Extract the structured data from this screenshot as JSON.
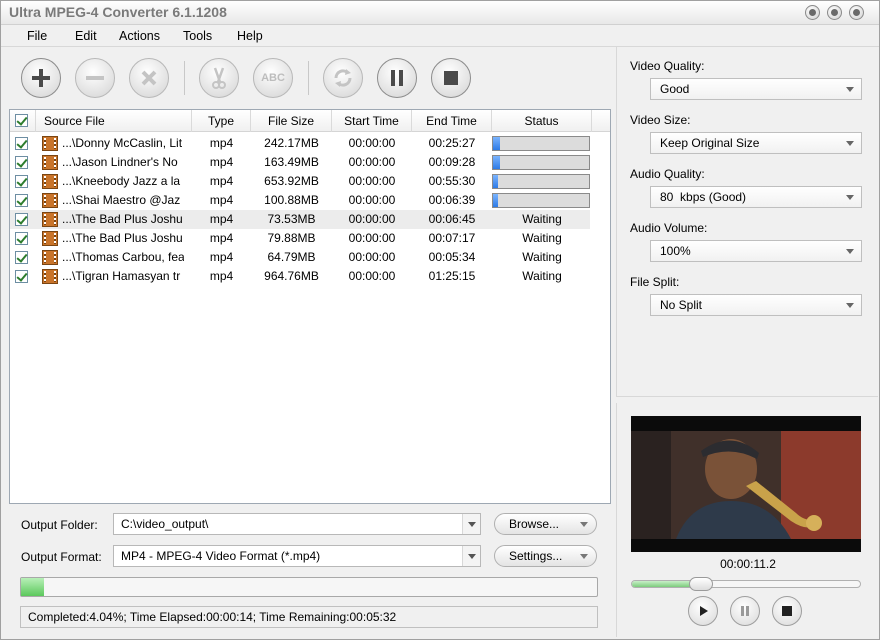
{
  "window": {
    "title": "Ultra MPEG-4 Converter 6.1.1208"
  },
  "menu": [
    "File",
    "Edit",
    "Actions",
    "Tools",
    "Help"
  ],
  "toolbar": {
    "buttons": [
      "add-icon",
      "remove-icon",
      "clear-icon",
      "cut-icon",
      "rename-icon",
      "convert-icon",
      "pause-icon",
      "stop-icon"
    ],
    "rename_label": "ABC"
  },
  "columns": [
    "Source File",
    "Type",
    "File Size",
    "Start Time",
    "End Time",
    "Status"
  ],
  "files": [
    {
      "name": "...\\Donny McCaslin, Lit",
      "type": "mp4",
      "size": "242.17MB",
      "start": "00:00:00",
      "end": "00:25:27",
      "status": "",
      "progress": 0.07
    },
    {
      "name": "...\\Jason Lindner's No",
      "type": "mp4",
      "size": "163.49MB",
      "start": "00:00:00",
      "end": "00:09:28",
      "status": "",
      "progress": 0.07
    },
    {
      "name": "...\\Kneebody  Jazz a la",
      "type": "mp4",
      "size": "653.92MB",
      "start": "00:00:00",
      "end": "00:55:30",
      "status": "",
      "progress": 0.05
    },
    {
      "name": "...\\Shai Maestro @Jaz",
      "type": "mp4",
      "size": "100.88MB",
      "start": "00:00:00",
      "end": "00:06:39",
      "status": "",
      "progress": 0.05
    },
    {
      "name": "...\\The Bad Plus Joshu",
      "type": "mp4",
      "size": "73.53MB",
      "start": "00:00:00",
      "end": "00:06:45",
      "status": "Waiting",
      "progress": null
    },
    {
      "name": "...\\The Bad Plus Joshu",
      "type": "mp4",
      "size": "79.88MB",
      "start": "00:00:00",
      "end": "00:07:17",
      "status": "Waiting",
      "progress": null
    },
    {
      "name": "...\\Thomas Carbou, fea",
      "type": "mp4",
      "size": "64.79MB",
      "start": "00:00:00",
      "end": "00:05:34",
      "status": "Waiting",
      "progress": null
    },
    {
      "name": "...\\Tigran Hamasyan tr",
      "type": "mp4",
      "size": "964.76MB",
      "start": "00:00:00",
      "end": "01:25:15",
      "status": "Waiting",
      "progress": null
    }
  ],
  "output": {
    "folder_label": "Output Folder:",
    "folder_value": "C:\\video_output\\",
    "browse_label": "Browse...",
    "format_label": "Output Format:",
    "format_value": "MP4 - MPEG-4 Video Format (*.mp4)",
    "settings_label": "Settings..."
  },
  "overall_progress": 0.0404,
  "status_text": "Completed:4.04%; Time Elapsed:00:00:14; Time Remaining:00:05:32",
  "settings": [
    {
      "label": "Video Quality:",
      "value": "Good"
    },
    {
      "label": "Video Size:",
      "value": "Keep Original Size"
    },
    {
      "label": "Audio Quality:",
      "value": "80  kbps (Good)"
    },
    {
      "label": "Audio Volume:",
      "value": "100%"
    },
    {
      "label": "File Split:",
      "value": "No Split"
    }
  ],
  "preview": {
    "time": "00:00:11.2",
    "seek_progress": 0.3
  }
}
